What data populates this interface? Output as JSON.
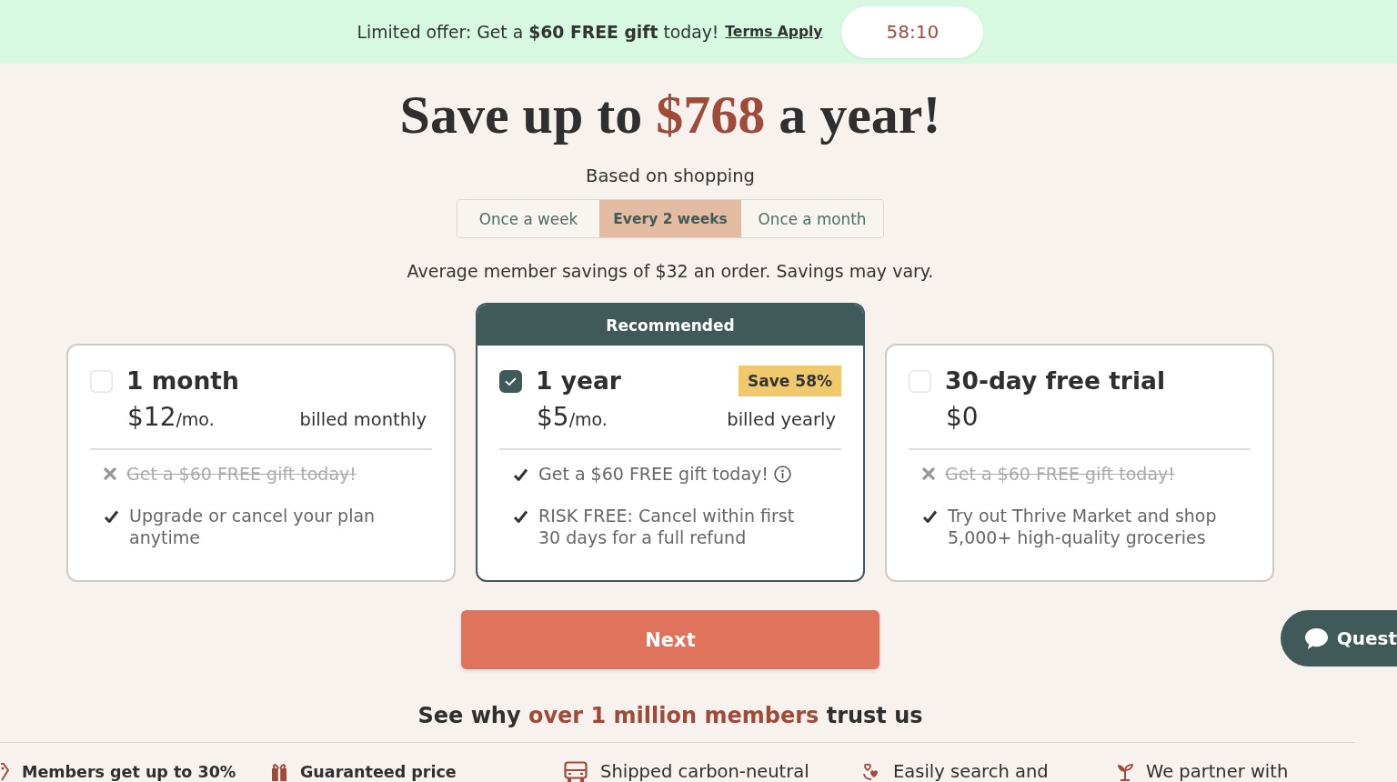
{
  "promo_banner": {
    "message": "Limited offer: Get a **$60 FREE gift** today!",
    "link": "Terms Apply",
    "timer": "58:10"
  },
  "headline": {
    "parts": [
      {
        "text": "Save up to ",
        "highlight": false
      },
      {
        "text": "$768",
        "highlight": true
      },
      {
        "text": " a year!",
        "highlight": false
      }
    ]
  },
  "frequency": {
    "label": "Based on shopping",
    "tabs": [
      {
        "label": "Once a week",
        "selected": false
      },
      {
        "label": "Every 2 weeks",
        "selected": true
      },
      {
        "label": "Once a month",
        "selected": false
      }
    ],
    "note": "Average member savings of $32 an order. Savings may vary."
  },
  "plans": [
    {
      "title": "1 month",
      "price": "$12",
      "unit": "/mo.",
      "billing": "billed monthly",
      "selected": false,
      "features": [
        {
          "text": "Get a $60 FREE gift today!",
          "included": false,
          "info": false
        },
        {
          "text": "Upgrade or cancel your plan anytime",
          "included": true,
          "info": false
        }
      ]
    },
    {
      "header": "Recommended",
      "title": "1 year",
      "badge": "Save 58%",
      "price": "$5",
      "unit": "/mo.",
      "billing": "billed yearly",
      "selected": true,
      "features": [
        {
          "text": "Get a $60 FREE gift today!",
          "included": true,
          "info": true
        },
        {
          "text": "RISK FREE: Cancel within first 30 days for a full refund",
          "included": true,
          "info": false
        }
      ]
    },
    {
      "title": "30-day free trial",
      "price": "$0",
      "selected": false,
      "features": [
        {
          "text": "Get a $60 FREE gift today!",
          "included": false,
          "info": false
        },
        {
          "text": "Try out Thrive Market and shop 5,000+ high-quality groceries",
          "included": true,
          "info": false
        }
      ]
    }
  ],
  "next_button": "Next",
  "trust": {
    "heading": {
      "parts": [
        {
          "text": "See why ",
          "highlight": false
        },
        {
          "text": "over 1 million members",
          "highlight": true
        },
        {
          "text": " trust us",
          "highlight": false
        }
      ]
    },
    "highlights": [
      {
        "text": "Members get up to 30%",
        "bold": true
      },
      {
        "text": "Guaranteed price",
        "bold": true
      },
      {
        "text": "Shipped carbon-neutral",
        "bold": false
      },
      {
        "text": "Easily search and",
        "bold": false
      },
      {
        "text": "We partner with",
        "bold": false
      }
    ]
  },
  "chat_button": "Quest"
}
